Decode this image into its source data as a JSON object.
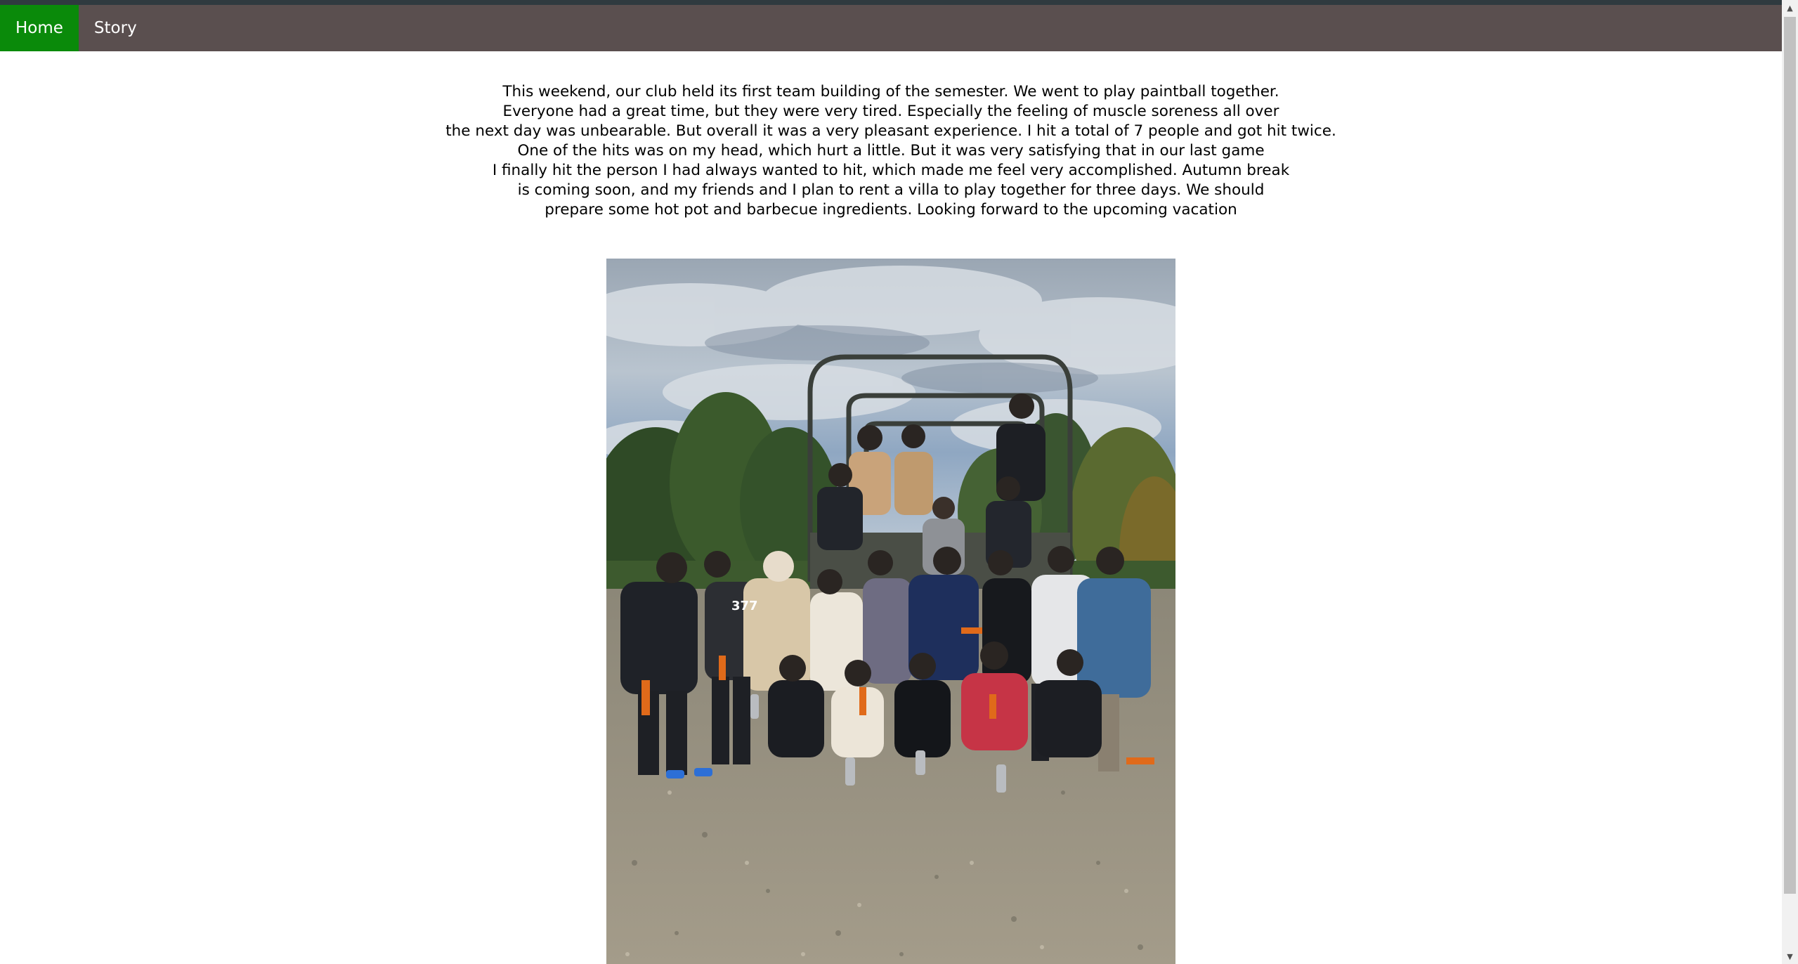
{
  "nav": {
    "items": [
      {
        "label": "Home",
        "active": true
      },
      {
        "label": "Story",
        "active": false
      }
    ],
    "active_color": "#0a8a0a",
    "bar_color": "#5a4f4f"
  },
  "story": {
    "lines": [
      "This weekend, our club held its first team building of the semester. We went to play paintball together.",
      "Everyone had a great time, but they were very tired. Especially the feeling of muscle soreness all over",
      "the next day was unbearable. But overall it was a very pleasant experience. I hit a total of 7 people and got hit twice.",
      "One of the hits was on my head, which hurt a little. But it was very satisfying that in our last game",
      "I finally hit the person I had always wanted to hit, which made me feel very accomplished. Autumn break",
      "is coming soon, and my friends and I plan to rent a villa to play together for three days. We should",
      "prepare some hot pot and barbecue ingredients. Looking forward to the upcoming vacation"
    ]
  },
  "photo": {
    "shirt_text": "377"
  },
  "icons": {
    "scroll_up": "▲",
    "scroll_down": "▼"
  }
}
